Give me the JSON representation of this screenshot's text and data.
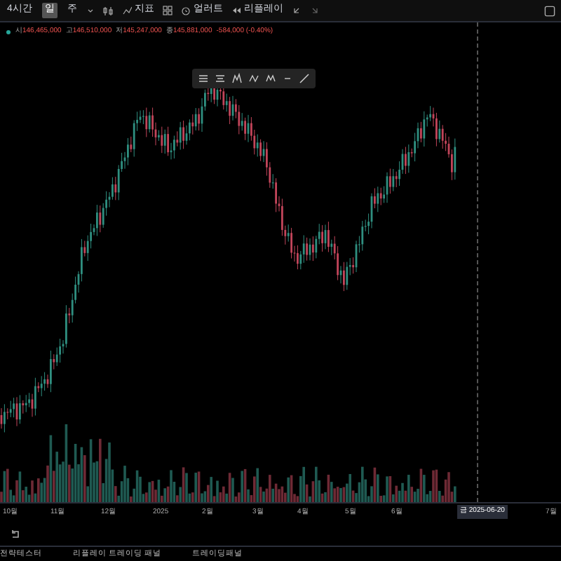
{
  "toolbar": {
    "intervals": [
      {
        "label": "4시간",
        "selected": false
      },
      {
        "label": "일",
        "selected": true
      },
      {
        "label": "주",
        "selected": false
      }
    ],
    "indicators": "지표",
    "alert": "얼러트",
    "replay": "리플레이"
  },
  "ohlc": [
    {
      "label": "시",
      "value": "146,465,000"
    },
    {
      "label": "고",
      "value": "146,510,000"
    },
    {
      "label": "저",
      "value": "145,247,000"
    },
    {
      "label": "종",
      "value": "145,881,000"
    }
  ],
  "change": "-584,000 (-0.40%)",
  "x_axis": [
    "10월",
    "11월",
    "12월",
    "2025",
    "2월",
    "3월",
    "4월",
    "5월",
    "6월",
    "7월"
  ],
  "crosshair_label": "금 2025-06-20",
  "bottom_tabs": [
    "전략테스터",
    "리플레이 트레이딩 패널",
    "트레이딩패널"
  ]
}
